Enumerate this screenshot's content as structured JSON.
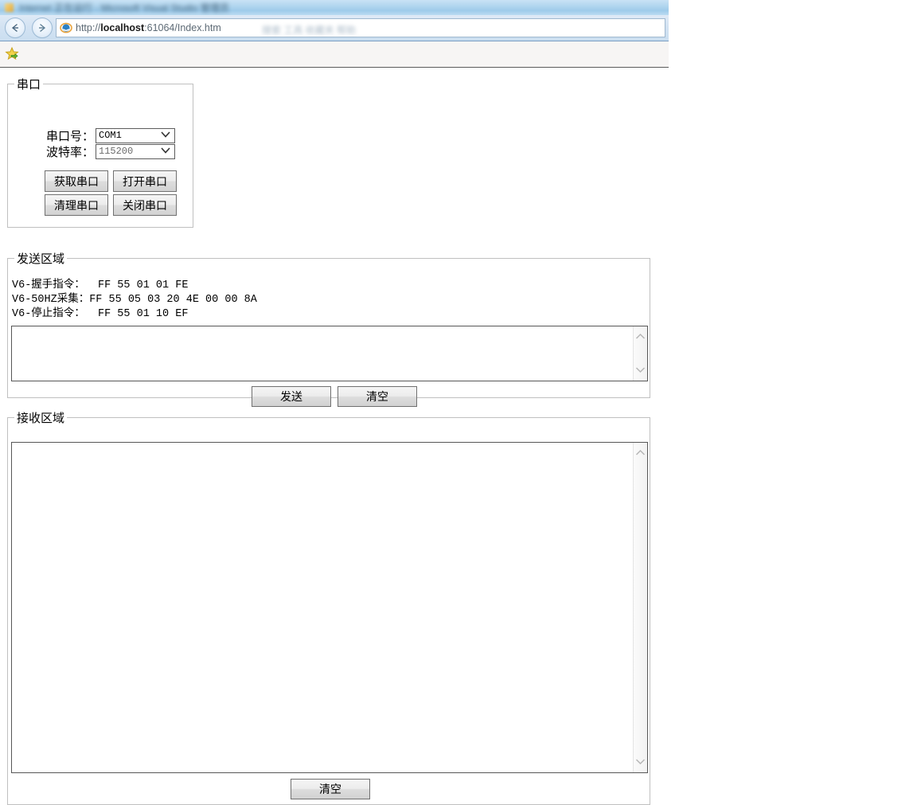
{
  "browser": {
    "title_blurred": "Internet 正在运行 - Microsoft Visual Studio 管理员",
    "url_prefix": "http://",
    "url_host": "localhost",
    "url_suffix": ":61064/Index.htm",
    "url_full": "http://localhost:61064/Index.htm",
    "toolbar_blurred": "搜索          工具      收藏夹      帮助",
    "back_label": "Back",
    "forward_label": "Forward",
    "favorites_label": "Favorites"
  },
  "serial": {
    "legend": "串口",
    "port_label": "串口号：",
    "baud_label": "波特率：",
    "port_value": "COM1",
    "baud_value": "115200",
    "port_options": [
      "COM1"
    ],
    "baud_options": [
      "115200"
    ],
    "buttons": [
      {
        "label": "获取串口",
        "name": "get-port-button"
      },
      {
        "label": "打开串口",
        "name": "open-port-button"
      },
      {
        "label": "清理串口",
        "name": "clean-port-button"
      },
      {
        "label": "关闭串口",
        "name": "close-port-button"
      }
    ]
  },
  "send": {
    "legend": "发送区域",
    "commands": [
      {
        "label": "V6-握手指令：",
        "hex": " FF 55 01 01 FE"
      },
      {
        "label": "V6-50HZ采集：",
        "hex": "FF 55 05 03 20 4E 00 00 8A"
      },
      {
        "label": "V6-停止指令：",
        "hex": " FF 55 01 10 EF"
      }
    ],
    "commands_text": "V6-握手指令：  FF 55 01 01 FE\nV6-50HZ采集：FF 55 05 03 20 4E 00 00 8A\nV6-停止指令：  FF 55 01 10 EF",
    "textarea_value": "",
    "textarea_placeholder": "",
    "send_button": "发送",
    "clear_button": "清空"
  },
  "receive": {
    "legend": "接收区域",
    "textarea_value": "",
    "textarea_placeholder": "",
    "clear_button": "清空"
  },
  "colors": {
    "chrome_blue": "#aed4ee",
    "button_face": "#ececec",
    "border": "#707070",
    "field_border": "#575757",
    "fieldset_border": "#c0c0c0"
  }
}
